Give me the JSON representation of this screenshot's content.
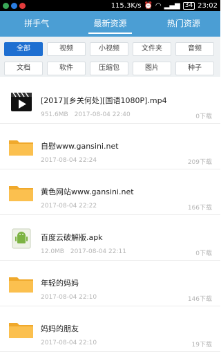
{
  "status": {
    "speed": "115.3K/s",
    "battery": "34",
    "time": "23:02"
  },
  "tabs": [
    {
      "label": "拼手气"
    },
    {
      "label": "最新资源"
    },
    {
      "label": "热门资源"
    }
  ],
  "filters": [
    "全部",
    "视频",
    "小视频",
    "文件夹",
    "音频",
    "文档",
    "软件",
    "压缩包",
    "图片",
    "种子"
  ],
  "items": [
    {
      "type": "video-icon",
      "name": "[2017][乡关何处][国语1080P].mp4",
      "size": "951.6MB",
      "date": "2017-08-04 22:40",
      "downloads": "0下载"
    },
    {
      "type": "folder-icon",
      "name": "自慰www.gansini.net",
      "size": "",
      "date": "2017-08-04 22:24",
      "downloads": "209下载"
    },
    {
      "type": "folder-icon",
      "name": "黄色网站www.gansini.net",
      "size": "",
      "date": "2017-08-04 22:22",
      "downloads": "166下载"
    },
    {
      "type": "apk-icon",
      "name": "百度云破解版.apk",
      "size": "12.0MB",
      "date": "2017-08-04 22:11",
      "downloads": "0下载"
    },
    {
      "type": "folder-icon",
      "name": "年轻的妈妈",
      "size": "",
      "date": "2017-08-04 22:10",
      "downloads": "146下载"
    },
    {
      "type": "folder-icon",
      "name": "妈妈的朋友",
      "size": "",
      "date": "2017-08-04 22:10",
      "downloads": "19下载"
    }
  ]
}
